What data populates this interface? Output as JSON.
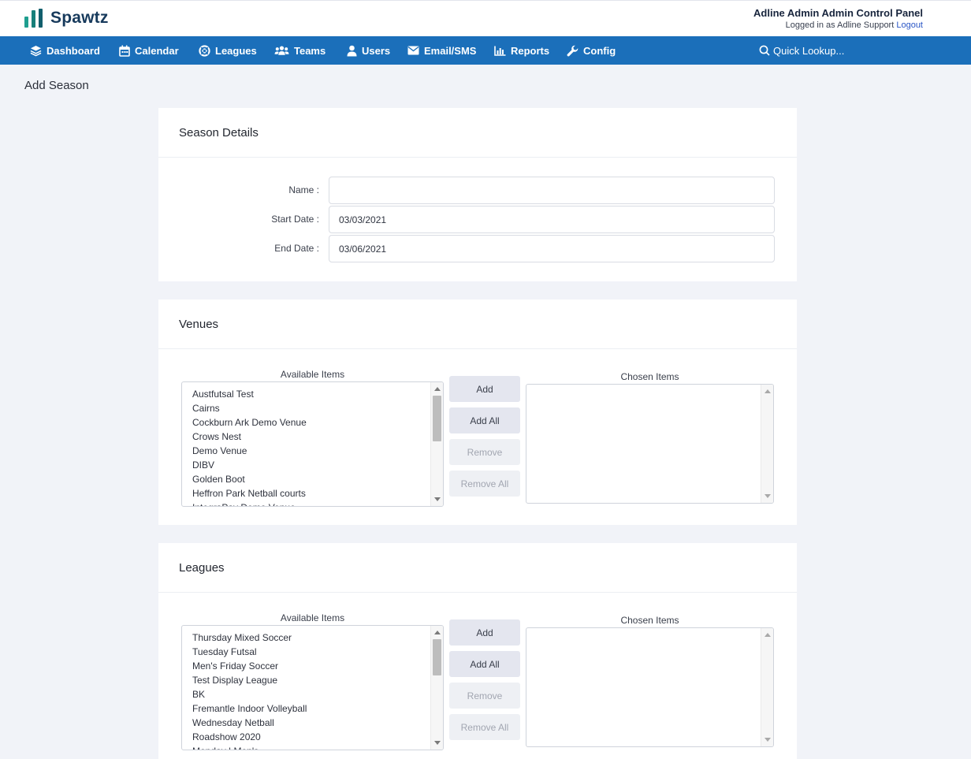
{
  "header": {
    "brand": "Spawtz",
    "panel_title": "Adline Admin Admin Control Panel",
    "logged_in_prefix": "Logged in as Adline Support",
    "logout_label": "Logout"
  },
  "nav": {
    "items": [
      {
        "label": "Dashboard",
        "icon": "layers-icon"
      },
      {
        "label": "Calendar",
        "icon": "calendar-icon"
      },
      {
        "label": "Leagues",
        "icon": "lifebuoy-icon"
      },
      {
        "label": "Teams",
        "icon": "users-group-icon"
      },
      {
        "label": "Users",
        "icon": "user-icon"
      },
      {
        "label": "Email/SMS",
        "icon": "envelope-icon"
      },
      {
        "label": "Reports",
        "icon": "bar-chart-icon"
      },
      {
        "label": "Config",
        "icon": "wrench-icon"
      }
    ],
    "quick_lookup": "Quick Lookup..."
  },
  "page": {
    "title": "Add Season"
  },
  "season_details": {
    "heading": "Season Details",
    "name_label": "Name :",
    "name_value": "",
    "start_label": "Start Date :",
    "start_value": "03/03/2021",
    "end_label": "End Date :",
    "end_value": "03/06/2021"
  },
  "venues": {
    "heading": "Venues",
    "available_label": "Available Items",
    "chosen_label": "Chosen Items",
    "available": [
      "Austfutsal Test",
      "Cairns",
      "Cockburn Ark Demo Venue",
      "Crows Nest",
      "Demo Venue",
      "DIBV",
      "Golden Boot",
      "Heffron Park Netball courts",
      "IntegraPay Demo Venue"
    ],
    "chosen": []
  },
  "leagues": {
    "heading": "Leagues",
    "available_label": "Available Items",
    "chosen_label": "Chosen Items",
    "available": [
      "Thursday Mixed Soccer",
      "Tuesday Futsal",
      "Men's Friday Soccer",
      "Test Display League",
      "BK",
      "Fremantle Indoor Volleyball",
      "Wednesday Netball",
      "Roadshow 2020",
      "Monday | Men's"
    ],
    "chosen": []
  },
  "buttons": {
    "add": "Add",
    "add_all": "Add All",
    "remove": "Remove",
    "remove_all": "Remove All"
  },
  "colors": {
    "nav_bg": "#1b6fba",
    "brand_teal": "#1f9e8f",
    "logout_link": "#2a56c6"
  }
}
